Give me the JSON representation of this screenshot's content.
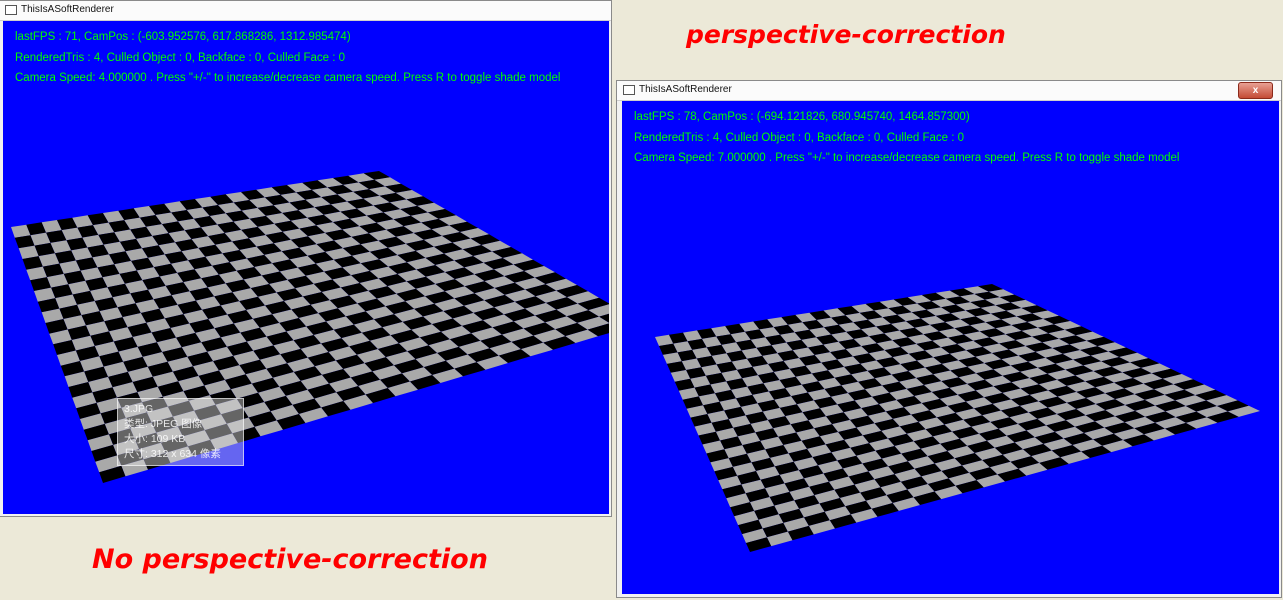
{
  "captions": {
    "right": "perspective-correction",
    "left": "No perspective-correction"
  },
  "left_window": {
    "title": "ThisIsASoftRenderer",
    "hud": {
      "line1": "lastFPS : 71, CamPos : (-603.952576, 617.868286, 1312.985474)",
      "line2": "RenderedTris : 4, Culled Object : 0, Backface : 0, Culled Face : 0",
      "line3": "Camera Speed: 4.000000 . Press \"+/-\" to increase/decrease camera speed. Press R to toggle shade model"
    },
    "file_overlay": {
      "name": "3.JPG",
      "type": "类型: JPEG 图像",
      "size": "大小: 109 KB",
      "dimensions": "尺寸: 312 x 634 像素"
    }
  },
  "right_window": {
    "title": "ThisIsASoftRenderer",
    "close_label": "x",
    "hud": {
      "line1": "lastFPS : 78, CamPos : (-694.121826, 680.945740, 1464.857300)",
      "line2": "RenderedTris : 4, Culled Object : 0, Backface : 0, Culled Face : 0",
      "line3": "Camera Speed: 7.000000 . Press \"+/-\" to increase/decrease camera speed. Press R to toggle shade model"
    }
  },
  "colors": {
    "viewport_bg": "#0000ff",
    "hud_text": "#00ff00",
    "caption": "#ff0000",
    "checker_light": "#a9a9a9",
    "checker_dark": "#000000"
  }
}
